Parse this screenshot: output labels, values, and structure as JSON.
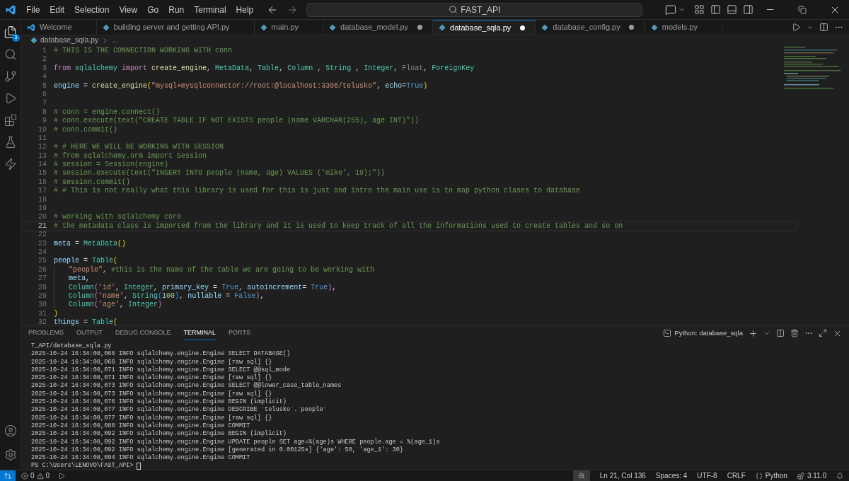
{
  "menu": [
    "File",
    "Edit",
    "Selection",
    "View",
    "Go",
    "Run",
    "Terminal",
    "Help"
  ],
  "search": {
    "value": "FAST_API"
  },
  "explorer_badge": "3",
  "tabs": [
    {
      "label": "Welcome",
      "kind": "welcome",
      "selected": false,
      "modified": false
    },
    {
      "label": "building server and getting API.py",
      "kind": "python",
      "selected": false,
      "modified": false
    },
    {
      "label": "main.py",
      "kind": "python",
      "selected": false,
      "modified": false
    },
    {
      "label": "database_model.py",
      "kind": "python",
      "selected": false,
      "modified": true
    },
    {
      "label": "database_sqla.py",
      "kind": "python",
      "selected": true,
      "modified": true
    },
    {
      "label": "database_config.py",
      "kind": "python",
      "selected": false,
      "modified": true
    },
    {
      "label": "models.py",
      "kind": "python",
      "selected": false,
      "modified": false
    }
  ],
  "breadcrumbs": [
    "database_sqla.py",
    "..."
  ],
  "lines": [
    {
      "number": "1",
      "current": false,
      "tokens": [
        {
          "t": "# THIS IS THE CONNECTION WORKING WITH conn",
          "kind": "cmt"
        }
      ]
    },
    {
      "number": "2",
      "current": false
    },
    {
      "number": "3",
      "current": false,
      "tokens": [
        {
          "t": "from",
          "kind": "kw"
        },
        {
          "t": " sqlalchemy",
          "kind": "mod"
        },
        {
          "t": " import",
          "kind": "kw"
        },
        {
          "t": " create_engine",
          "kind": "fn"
        },
        {
          "t": ", ",
          "kind": "op"
        },
        {
          "t": "MetaData",
          "kind": "mod"
        },
        {
          "t": ", ",
          "kind": "op"
        },
        {
          "t": "Table",
          "kind": "mod"
        },
        {
          "t": ", ",
          "kind": "op"
        },
        {
          "t": "Column",
          "kind": "mod"
        },
        {
          "t": " , ",
          "kind": "op"
        },
        {
          "t": "String",
          "kind": "mod"
        },
        {
          "t": " , ",
          "kind": "op"
        },
        {
          "t": "Integer",
          "kind": "mod"
        },
        {
          "t": ", ",
          "kind": "op"
        },
        {
          "t": "Float",
          "kind": "dim"
        },
        {
          "t": ", ",
          "kind": "op"
        },
        {
          "t": "ForeignKey",
          "kind": "mod"
        }
      ]
    },
    {
      "number": "4",
      "current": false
    },
    {
      "number": "5",
      "current": false,
      "tokens": [
        {
          "t": "engine",
          "kind": "var"
        },
        {
          "t": " = ",
          "kind": "op"
        },
        {
          "t": "create_engine",
          "kind": "fn"
        },
        {
          "t": "(",
          "kind": "p1"
        },
        {
          "t": "\"mysql+mysqlconnector://root:@localhost:3306/telusko\"",
          "kind": "str"
        },
        {
          "t": ", ",
          "kind": "op"
        },
        {
          "t": "echo",
          "kind": "var"
        },
        {
          "t": "=",
          "kind": "op"
        },
        {
          "t": "True",
          "kind": "const"
        },
        {
          "t": ")",
          "kind": "p1"
        }
      ]
    },
    {
      "number": "6",
      "current": false
    },
    {
      "number": "7",
      "current": false
    },
    {
      "number": "8",
      "current": false,
      "tokens": [
        {
          "t": "# conn = engine.connect()",
          "kind": "cmt"
        }
      ]
    },
    {
      "number": "9",
      "current": false,
      "tokens": [
        {
          "t": "# conn.execute(text(\"CREATE TABLE IF NOT EXISTS people (name VARCHAR(255), age INT)\"))",
          "kind": "cmt"
        }
      ]
    },
    {
      "number": "10",
      "current": false,
      "tokens": [
        {
          "t": "# conn.commit()",
          "kind": "cmt"
        }
      ]
    },
    {
      "number": "11",
      "current": false
    },
    {
      "number": "12",
      "current": false,
      "tokens": [
        {
          "t": "# # HERE WE WILL BE WORKING WITH SESSION",
          "kind": "cmt"
        }
      ]
    },
    {
      "number": "13",
      "current": false,
      "tokens": [
        {
          "t": "# from sqlalchemy.orm import Session",
          "kind": "cmt"
        }
      ]
    },
    {
      "number": "14",
      "current": false,
      "tokens": [
        {
          "t": "# session = Session(engine)",
          "kind": "cmt"
        }
      ]
    },
    {
      "number": "15",
      "current": false,
      "tokens": [
        {
          "t": "# session.execute(text(\"INSERT INTO people (name, age) VALUES ('mike', 19);\"))",
          "kind": "cmt"
        }
      ]
    },
    {
      "number": "16",
      "current": false,
      "tokens": [
        {
          "t": "# session.commit()",
          "kind": "cmt"
        }
      ]
    },
    {
      "number": "17",
      "current": false,
      "tokens": [
        {
          "t": "# # This is not really what this library is used for this is just and intro the main use is to map python clases to database",
          "kind": "cmt"
        }
      ]
    },
    {
      "number": "18",
      "current": false
    },
    {
      "number": "19",
      "current": false
    },
    {
      "number": "20",
      "current": false,
      "tokens": [
        {
          "t": "# working with sqlalchemy core",
          "kind": "cmt"
        }
      ]
    },
    {
      "number": "21",
      "current": true,
      "tokens": [
        {
          "t": "# the metadata class is imported from the library and it is used to keep track of all the informations used to create tables and so on",
          "kind": "cmt"
        }
      ]
    },
    {
      "number": "22",
      "current": false
    },
    {
      "number": "23",
      "current": false,
      "tokens": [
        {
          "t": "meta",
          "kind": "var"
        },
        {
          "t": " = ",
          "kind": "op"
        },
        {
          "t": "MetaData",
          "kind": "mod"
        },
        {
          "t": "()",
          "kind": "p1"
        }
      ]
    },
    {
      "number": "24",
      "current": false
    },
    {
      "number": "25",
      "current": false,
      "tokens": [
        {
          "t": "people",
          "kind": "var"
        },
        {
          "t": " = ",
          "kind": "op"
        },
        {
          "t": "Table",
          "kind": "mod"
        },
        {
          "t": "(",
          "kind": "p1"
        }
      ]
    },
    {
      "number": "26",
      "current": false,
      "indented": true,
      "tokens": [
        {
          "t": "\"people\"",
          "kind": "str"
        },
        {
          "t": ", ",
          "kind": "op"
        },
        {
          "t": "#this is the name of the table we are going to be working with",
          "kind": "cmt"
        }
      ]
    },
    {
      "number": "27",
      "current": false,
      "indented": true,
      "tokens": [
        {
          "t": "meta",
          "kind": "var"
        },
        {
          "t": ",",
          "kind": "op"
        }
      ]
    },
    {
      "number": "28",
      "current": false,
      "indented": true,
      "tokens": [
        {
          "t": "Column",
          "kind": "mod"
        },
        {
          "t": "(",
          "kind": "p2"
        },
        {
          "t": "'id'",
          "kind": "str"
        },
        {
          "t": ", ",
          "kind": "op"
        },
        {
          "t": "Integer",
          "kind": "mod"
        },
        {
          "t": ", ",
          "kind": "op"
        },
        {
          "t": "primary_key",
          "kind": "var"
        },
        {
          "t": " = ",
          "kind": "op"
        },
        {
          "t": "True",
          "kind": "const"
        },
        {
          "t": ", ",
          "kind": "op"
        },
        {
          "t": "autoincrement",
          "kind": "var"
        },
        {
          "t": "= ",
          "kind": "op"
        },
        {
          "t": "True",
          "kind": "const"
        },
        {
          "t": ")",
          "kind": "p2"
        },
        {
          "t": ",",
          "kind": "op"
        }
      ]
    },
    {
      "number": "29",
      "current": false,
      "indented": true,
      "tokens": [
        {
          "t": "Column",
          "kind": "mod"
        },
        {
          "t": "(",
          "kind": "p2"
        },
        {
          "t": "'name'",
          "kind": "str"
        },
        {
          "t": ", ",
          "kind": "op"
        },
        {
          "t": "String",
          "kind": "mod"
        },
        {
          "t": "(",
          "kind": "p3"
        },
        {
          "t": "100",
          "kind": "num"
        },
        {
          "t": ")",
          "kind": "p3"
        },
        {
          "t": ", ",
          "kind": "op"
        },
        {
          "t": "nullable",
          "kind": "var"
        },
        {
          "t": " = ",
          "kind": "op"
        },
        {
          "t": "False",
          "kind": "const"
        },
        {
          "t": ")",
          "kind": "p2"
        },
        {
          "t": ",",
          "kind": "op"
        }
      ]
    },
    {
      "number": "30",
      "current": false,
      "indented": true,
      "tokens": [
        {
          "t": "Column",
          "kind": "mod"
        },
        {
          "t": "(",
          "kind": "p2"
        },
        {
          "t": "'age'",
          "kind": "str"
        },
        {
          "t": ", ",
          "kind": "op"
        },
        {
          "t": "Integer",
          "kind": "mod"
        },
        {
          "t": ")",
          "kind": "p2"
        }
      ]
    },
    {
      "number": "31",
      "current": false,
      "tokens": [
        {
          "t": ")",
          "kind": "p1"
        }
      ]
    },
    {
      "number": "32",
      "current": false,
      "tokens": [
        {
          "t": "things",
          "kind": "var"
        },
        {
          "t": " = ",
          "kind": "op"
        },
        {
          "t": "Table",
          "kind": "mod"
        },
        {
          "t": "(",
          "kind": "p1"
        }
      ]
    }
  ],
  "panel_tabs": [
    {
      "label": "PROBLEMS",
      "selected": false
    },
    {
      "label": "OUTPUT",
      "selected": false
    },
    {
      "label": "DEBUG CONSOLE",
      "selected": false
    },
    {
      "label": "TERMINAL",
      "selected": true
    },
    {
      "label": "PORTS",
      "selected": false
    }
  ],
  "terminal_name": "Python: database_sqla",
  "terminal_lines": [
    "T_API/database_sqla.py",
    "2025-10-24 16:34:08,066 INFO sqlalchemy.engine.Engine SELECT DATABASE()",
    "2025-10-24 16:34:08,066 INFO sqlalchemy.engine.Engine [raw sql] {}",
    "2025-10-24 16:34:08,071 INFO sqlalchemy.engine.Engine SELECT @@sql_mode",
    "2025-10-24 16:34:08,071 INFO sqlalchemy.engine.Engine [raw sql] {}",
    "2025-10-24 16:34:08,073 INFO sqlalchemy.engine.Engine SELECT @@lower_case_table_names",
    "2025-10-24 16:34:08,073 INFO sqlalchemy.engine.Engine [raw sql] {}",
    "2025-10-24 16:34:08,076 INFO sqlalchemy.engine.Engine BEGIN (implicit)",
    "2025-10-24 16:34:08,077 INFO sqlalchemy.engine.Engine DESCRIBE `telusko`.`people`",
    "2025-10-24 16:34:08,077 INFO sqlalchemy.engine.Engine [raw sql] {}",
    "2025-10-24 16:34:08,088 INFO sqlalchemy.engine.Engine COMMIT",
    "2025-10-24 16:34:08,092 INFO sqlalchemy.engine.Engine BEGIN (implicit)",
    "2025-10-24 16:34:08,092 INFO sqlalchemy.engine.Engine UPDATE people SET age=%(age)s WHERE people.age = %(age_1)s",
    "2025-10-24 16:34:08,092 INFO sqlalchemy.engine.Engine [generated in 0.00125s] {'age': 50, 'age_1': 30}",
    "2025-10-24 16:34:08,094 INFO sqlalchemy.engine.Engine COMMIT"
  ],
  "prompt": "PS C:\\Users\\LENOVO\\FAST_API>",
  "status": {
    "errors": "0",
    "warnings": "0",
    "position": "Ln 21, Col 136",
    "indent": "Spaces: 4",
    "encoding": "UTF-8",
    "eol": "CRLF",
    "language": "Python",
    "version": "3.11.0"
  }
}
